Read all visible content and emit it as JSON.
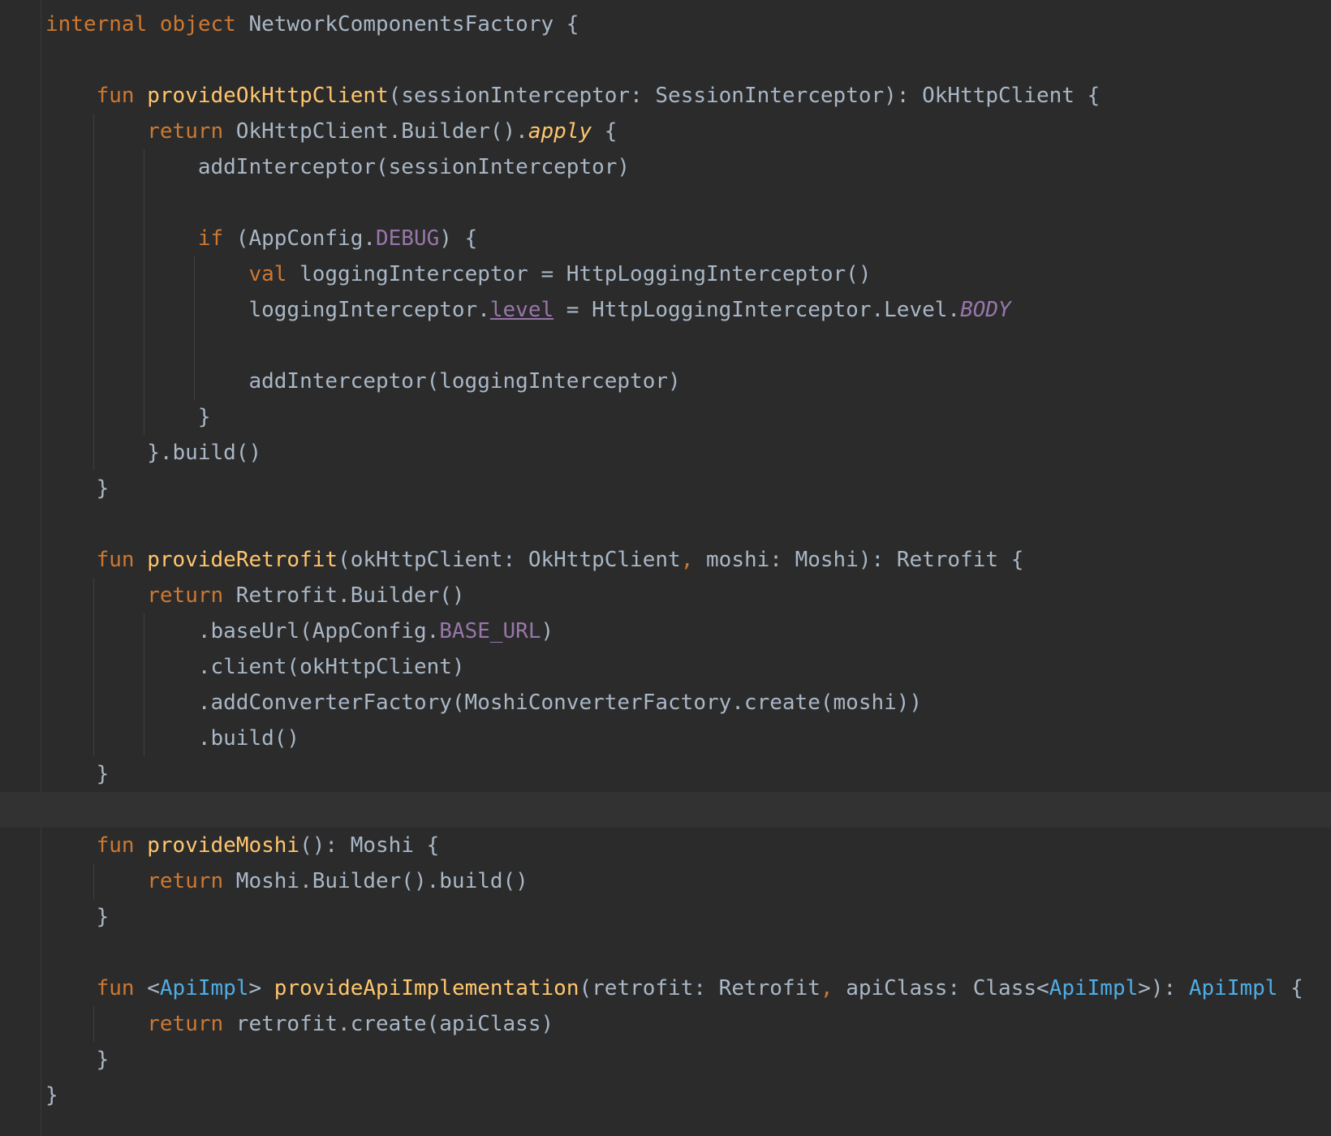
{
  "editor": {
    "language": "Kotlin",
    "colors": {
      "background": "#2b2b2b",
      "keyword": "#cc7832",
      "function": "#ffc66d",
      "text": "#a9b7c6",
      "constant": "#9876aa",
      "generic": "#4eade5",
      "current_line": "#323232"
    },
    "lines": [
      [
        {
          "t": "internal",
          "c": "kw"
        },
        {
          "t": " ",
          "c": "pn"
        },
        {
          "t": "object",
          "c": "kw"
        },
        {
          "t": " NetworkComponentsFactory {",
          "c": "pn"
        }
      ],
      [],
      [
        {
          "t": "    ",
          "c": "pn"
        },
        {
          "t": "fun",
          "c": "kw"
        },
        {
          "t": " ",
          "c": "pn"
        },
        {
          "t": "provideOkHttpClient",
          "c": "fn"
        },
        {
          "t": "(sessionInterceptor: SessionInterceptor): OkHttpClient {",
          "c": "pn"
        }
      ],
      [
        {
          "t": "        ",
          "c": "pn"
        },
        {
          "t": "return",
          "c": "kw"
        },
        {
          "t": " OkHttpClient.Builder().",
          "c": "pn"
        },
        {
          "t": "apply",
          "c": "it"
        },
        {
          "t": " {",
          "c": "pn"
        }
      ],
      [
        {
          "t": "            addInterceptor(sessionInterceptor)",
          "c": "pn"
        }
      ],
      [],
      [
        {
          "t": "            ",
          "c": "pn"
        },
        {
          "t": "if",
          "c": "kw"
        },
        {
          "t": " (AppConfig.",
          "c": "pn"
        },
        {
          "t": "DEBUG",
          "c": "cst"
        },
        {
          "t": ") {",
          "c": "pn"
        }
      ],
      [
        {
          "t": "                ",
          "c": "pn"
        },
        {
          "t": "val",
          "c": "kw"
        },
        {
          "t": " loggingInterceptor = HttpLoggingInterceptor()",
          "c": "pn"
        }
      ],
      [
        {
          "t": "                loggingInterceptor.",
          "c": "pn"
        },
        {
          "t": "level",
          "c": "cst und"
        },
        {
          "t": " = HttpLoggingInterceptor.Level.",
          "c": "pn"
        },
        {
          "t": "BODY",
          "c": "itp"
        }
      ],
      [],
      [
        {
          "t": "                addInterceptor(loggingInterceptor)",
          "c": "pn"
        }
      ],
      [
        {
          "t": "            }",
          "c": "pn"
        }
      ],
      [
        {
          "t": "        }.build()",
          "c": "pn"
        }
      ],
      [
        {
          "t": "    }",
          "c": "pn"
        }
      ],
      [],
      [
        {
          "t": "    ",
          "c": "pn"
        },
        {
          "t": "fun",
          "c": "kw"
        },
        {
          "t": " ",
          "c": "pn"
        },
        {
          "t": "provideRetrofit",
          "c": "fn"
        },
        {
          "t": "(okHttpClient: OkHttpClient",
          "c": "pn"
        },
        {
          "t": ",",
          "c": "cm"
        },
        {
          "t": " moshi: Moshi): Retrofit {",
          "c": "pn"
        }
      ],
      [
        {
          "t": "        ",
          "c": "pn"
        },
        {
          "t": "return",
          "c": "kw"
        },
        {
          "t": " Retrofit.Builder()",
          "c": "pn"
        }
      ],
      [
        {
          "t": "            .baseUrl(AppConfig.",
          "c": "pn"
        },
        {
          "t": "BASE_URL",
          "c": "cst"
        },
        {
          "t": ")",
          "c": "pn"
        }
      ],
      [
        {
          "t": "            .client(okHttpClient)",
          "c": "pn"
        }
      ],
      [
        {
          "t": "            .addConverterFactory(MoshiConverterFactory.create(moshi))",
          "c": "pn"
        }
      ],
      [
        {
          "t": "            .build()",
          "c": "pn"
        }
      ],
      [
        {
          "t": "    }",
          "c": "pn"
        }
      ],
      [],
      [
        {
          "t": "    ",
          "c": "pn"
        },
        {
          "t": "fun",
          "c": "kw"
        },
        {
          "t": " ",
          "c": "pn"
        },
        {
          "t": "provideMoshi",
          "c": "fn"
        },
        {
          "t": "(): Moshi {",
          "c": "pn"
        }
      ],
      [
        {
          "t": "        ",
          "c": "pn"
        },
        {
          "t": "return",
          "c": "kw"
        },
        {
          "t": " Moshi.Builder().build()",
          "c": "pn"
        }
      ],
      [
        {
          "t": "    }",
          "c": "pn"
        }
      ],
      [],
      [
        {
          "t": "    ",
          "c": "pn"
        },
        {
          "t": "fun",
          "c": "kw"
        },
        {
          "t": " <",
          "c": "pn"
        },
        {
          "t": "ApiImpl",
          "c": "gen"
        },
        {
          "t": "> ",
          "c": "pn"
        },
        {
          "t": "provideApiImplementation",
          "c": "fn"
        },
        {
          "t": "(retrofit: Retrofit",
          "c": "pn"
        },
        {
          "t": ",",
          "c": "cm"
        },
        {
          "t": " apiClass: Class<",
          "c": "pn"
        },
        {
          "t": "ApiImpl",
          "c": "gen"
        },
        {
          "t": ">): ",
          "c": "pn"
        },
        {
          "t": "ApiImpl",
          "c": "gen"
        },
        {
          "t": " {",
          "c": "pn"
        }
      ],
      [
        {
          "t": "        ",
          "c": "pn"
        },
        {
          "t": "return",
          "c": "kw"
        },
        {
          "t": " retrofit.create(apiClass)",
          "c": "pn"
        }
      ],
      [
        {
          "t": "    }",
          "c": "pn"
        }
      ],
      [
        {
          "t": "}",
          "c": "pn"
        }
      ]
    ]
  }
}
